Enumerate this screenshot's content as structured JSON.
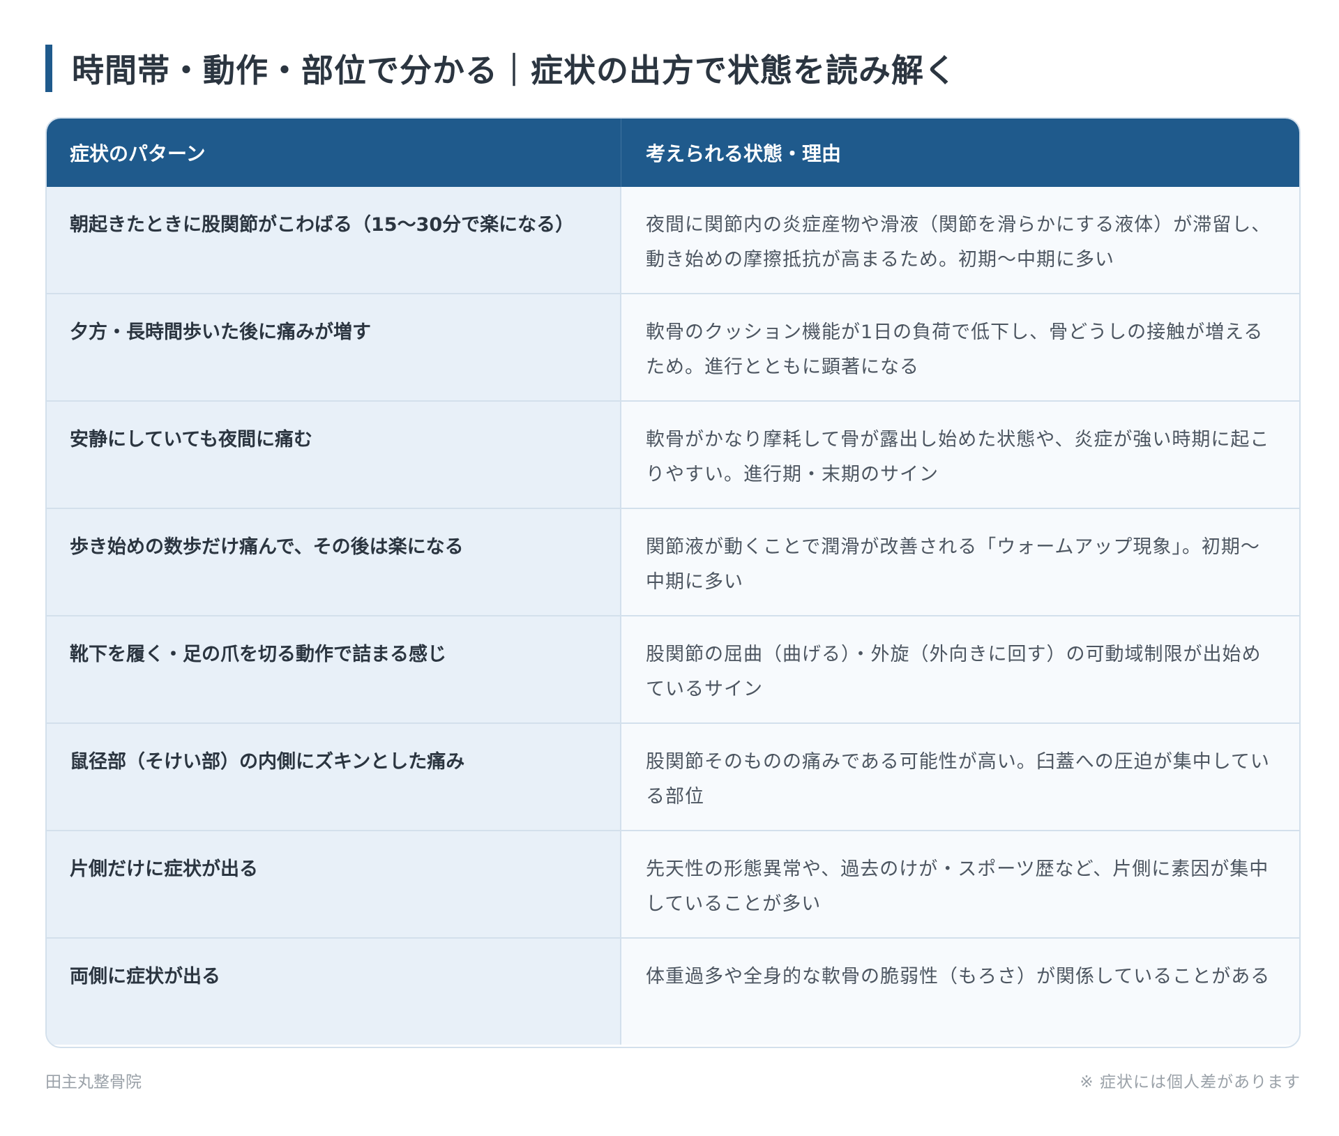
{
  "title": "時間帯・動作・部位で分かる｜症状の出方で状態を読み解く",
  "table": {
    "headers": [
      "症状のパターン",
      "考えられる状態・理由"
    ],
    "rows": [
      {
        "pattern": "朝起きたときに股関節がこわばる（15〜30分で楽になる）",
        "reason": "夜間に関節内の炎症産物や滑液（関節を滑らかにする液体）が滞留し、動き始めの摩擦抵抗が高まるため。初期〜中期に多い"
      },
      {
        "pattern": "夕方・長時間歩いた後に痛みが増す",
        "reason": "軟骨のクッション機能が1日の負荷で低下し、骨どうしの接触が増えるため。進行とともに顕著になる"
      },
      {
        "pattern": "安静にしていても夜間に痛む",
        "reason": "軟骨がかなり摩耗して骨が露出し始めた状態や、炎症が強い時期に起こりやすい。進行期・末期のサイン"
      },
      {
        "pattern": "歩き始めの数歩だけ痛んで、その後は楽になる",
        "reason": "関節液が動くことで潤滑が改善される「ウォームアップ現象」。初期〜中期に多い"
      },
      {
        "pattern": "靴下を履く・足の爪を切る動作で詰まる感じ",
        "reason": "股関節の屈曲（曲げる）・外旋（外向きに回す）の可動域制限が出始めているサイン"
      },
      {
        "pattern": "鼠径部（そけい部）の内側にズキンとした痛み",
        "reason": "股関節そのものの痛みである可能性が高い。臼蓋への圧迫が集中している部位"
      },
      {
        "pattern": "片側だけに症状が出る",
        "reason": "先天性の形態異常や、過去のけが・スポーツ歴など、片側に素因が集中していることが多い"
      },
      {
        "pattern": "両側に症状が出る",
        "reason": "体重過多や全身的な軟骨の脆弱性（もろさ）が関係していることがある"
      }
    ]
  },
  "footer": {
    "clinic": "田主丸整骨院",
    "note": "※ 症状には個人差があります"
  },
  "colors": {
    "accent": "#1f5a8c",
    "header_bg": "#1f5a8c",
    "left_col_bg": "#e8f0f8",
    "right_col_bg": "#f7fafd",
    "border": "#d3e0ec"
  }
}
